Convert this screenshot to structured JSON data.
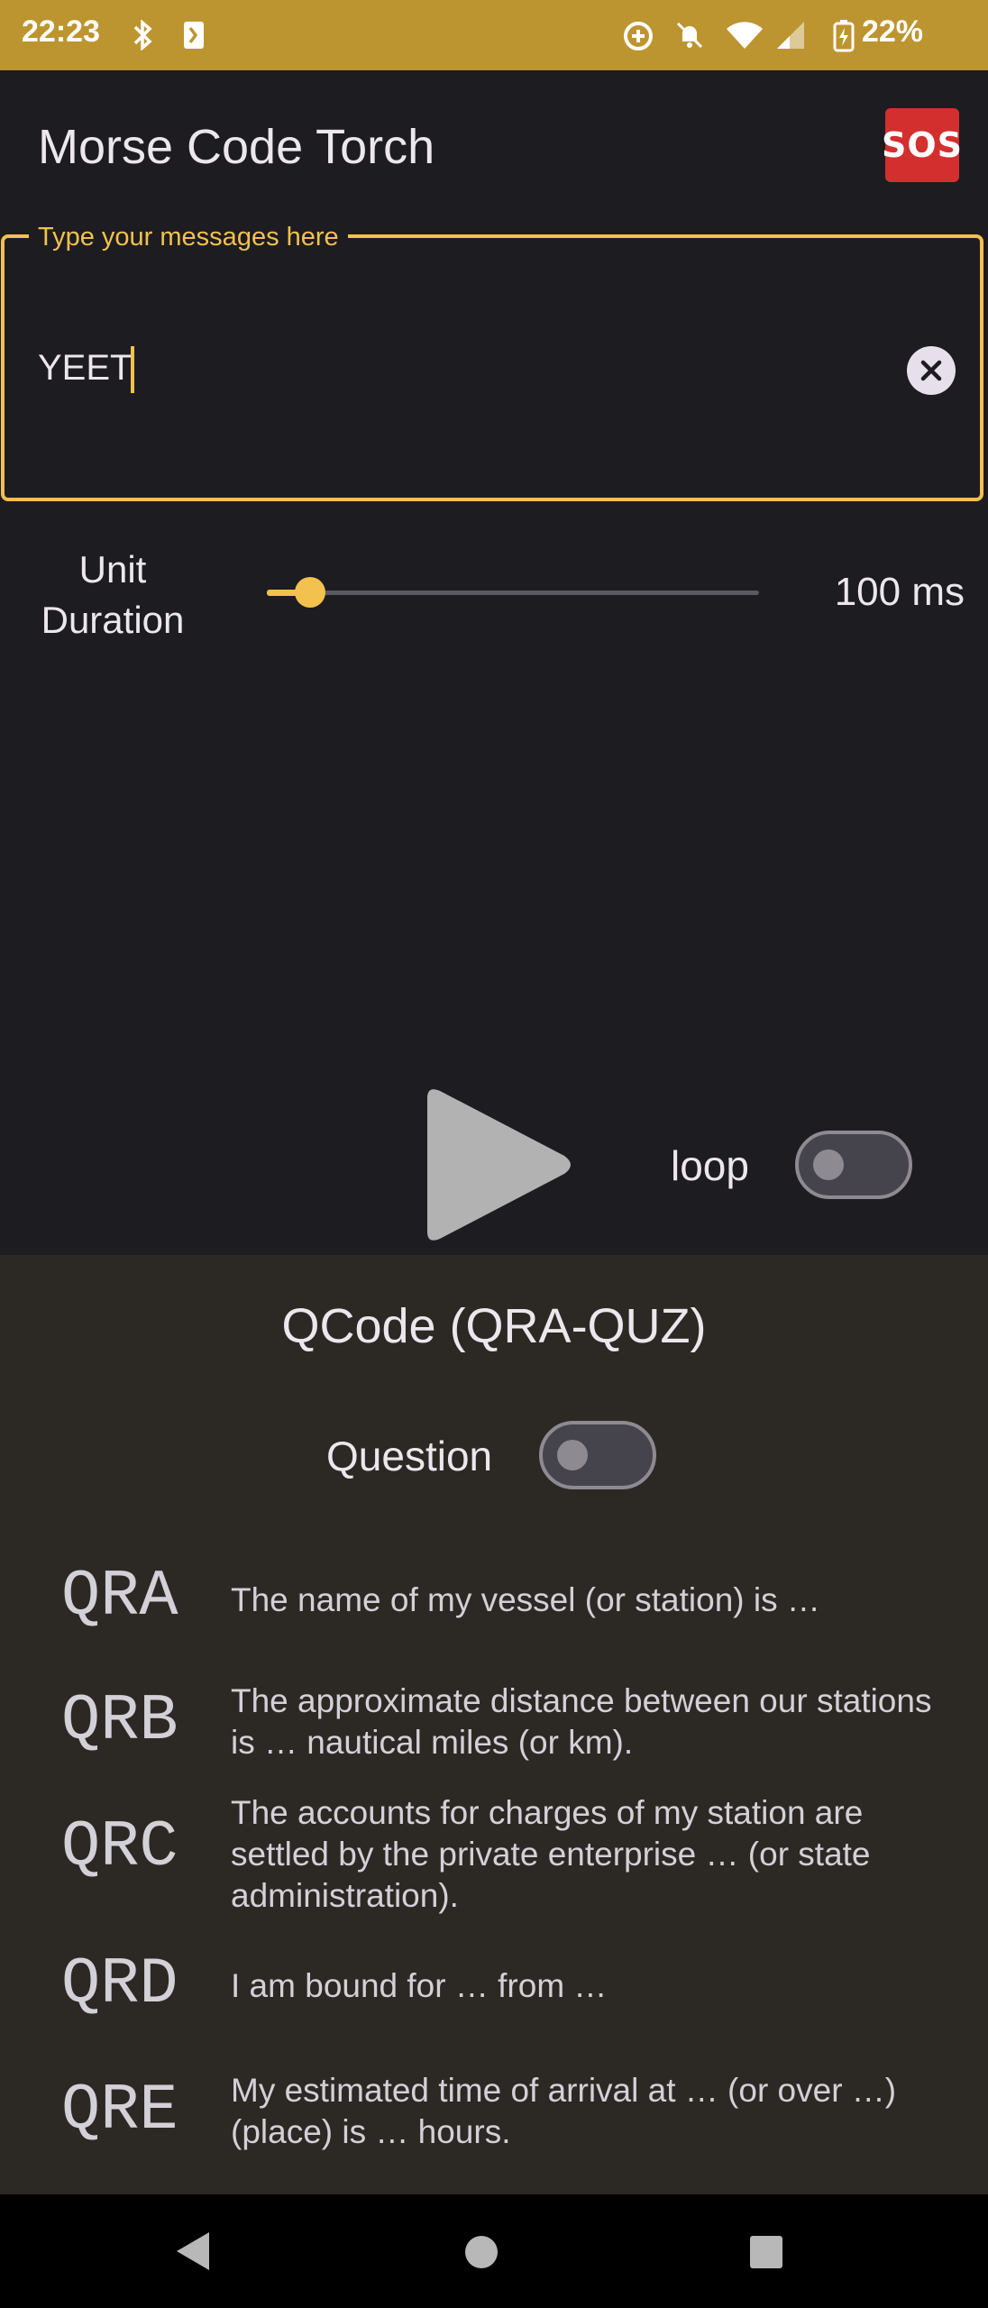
{
  "status_bar": {
    "time": "22:23",
    "battery": "22%",
    "icons": [
      "bluetooth-icon",
      "nfc-icon",
      "data-saver-icon",
      "do-not-disturb-icon",
      "wifi-icon",
      "signal-icon",
      "battery-charging-icon"
    ]
  },
  "app_bar": {
    "title": "Morse Code Torch",
    "sos_label": "SOS"
  },
  "message_field": {
    "label": "Type your messages here",
    "value": "YEET"
  },
  "unit_duration": {
    "label_line1": "Unit",
    "label_line2": "Duration",
    "value_text": "100 ms",
    "slider_fraction": 0.09
  },
  "controls": {
    "loop_label": "loop",
    "loop_on": false
  },
  "qcode_panel": {
    "title": "QCode (QRA-QUZ)",
    "question_label": "Question",
    "question_on": false,
    "items": [
      {
        "code": "QRA",
        "desc": "The name of my vessel (or station) is …"
      },
      {
        "code": "QRB",
        "desc": "The approximate distance between our stations is … nautical miles (or km)."
      },
      {
        "code": "QRC",
        "desc": "The accounts for charges of my station are settled by the private enterprise … (or state administration)."
      },
      {
        "code": "QRD",
        "desc": "I am bound for … from …"
      },
      {
        "code": "QRE",
        "desc": "My estimated time of arrival at … (or over …) (place) is … hours."
      }
    ]
  },
  "colors": {
    "accent": "#f2c14e",
    "status_bar": "#bd9530",
    "background": "#1d1c21",
    "panel": "#2c2925",
    "sos": "#d32f2f"
  }
}
